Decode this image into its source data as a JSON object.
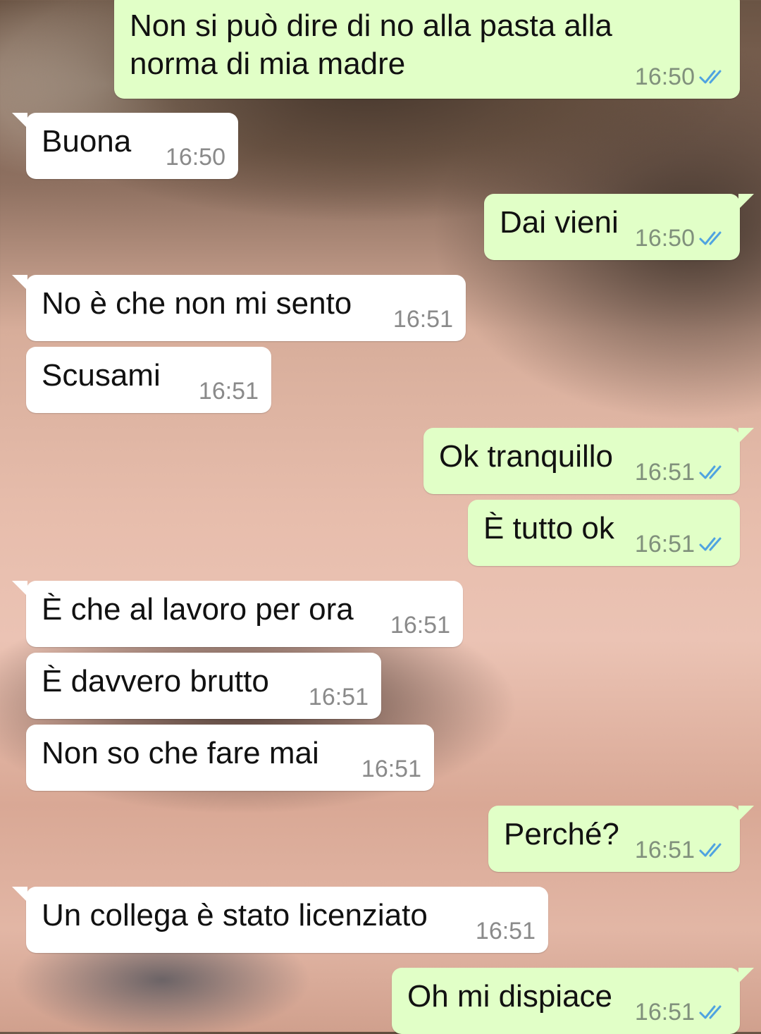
{
  "colors": {
    "incoming_bubble": "#ffffff",
    "outgoing_bubble": "#e1ffc7",
    "read_tick": "#4fa3e0",
    "timestamp": "#8a8a8a"
  },
  "messages": [
    {
      "text": "Non si può dire di no alla pasta alla",
      "text2": "norma di mia madre",
      "time": "16:50",
      "status_icon": "double-check-read-icon"
    },
    {
      "text": "Buona",
      "time": "16:50"
    },
    {
      "text": "Dai vieni",
      "time": "16:50",
      "status_icon": "double-check-read-icon"
    },
    {
      "text": "No è che non mi sento",
      "time": "16:51"
    },
    {
      "text": "Scusami",
      "time": "16:51"
    },
    {
      "text": "Ok tranquillo",
      "time": "16:51",
      "status_icon": "double-check-read-icon"
    },
    {
      "text": "È tutto ok",
      "time": "16:51",
      "status_icon": "double-check-read-icon"
    },
    {
      "text": "È che al lavoro per ora",
      "time": "16:51"
    },
    {
      "text": "È davvero brutto",
      "time": "16:51"
    },
    {
      "text": "Non so che fare mai",
      "time": "16:51"
    },
    {
      "text": "Perché?",
      "time": "16:51",
      "status_icon": "double-check-read-icon"
    },
    {
      "text": "Un collega è stato licenziato",
      "time": "16:51"
    },
    {
      "text": "Oh mi dispiace",
      "time": "16:51",
      "status_icon": "double-check-read-icon"
    }
  ]
}
